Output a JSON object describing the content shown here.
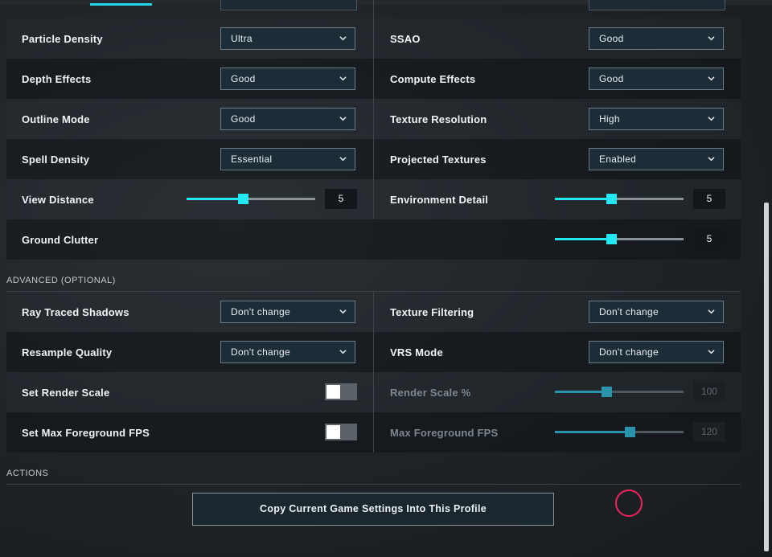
{
  "header": {
    "active_tab_color": "#21d4e8"
  },
  "graphics_settings": {
    "left": [
      {
        "label": "Particle Density",
        "type": "select",
        "value": "Ultra"
      },
      {
        "label": "Depth Effects",
        "type": "select",
        "value": "Good"
      },
      {
        "label": "Outline Mode",
        "type": "select",
        "value": "Good"
      },
      {
        "label": "Spell Density",
        "type": "select",
        "value": "Essential"
      },
      {
        "label": "View Distance",
        "type": "slider",
        "value": "5",
        "fraction": 0.44
      }
    ],
    "right": [
      {
        "label": "SSAO",
        "type": "select",
        "value": "Good"
      },
      {
        "label": "Compute Effects",
        "type": "select",
        "value": "Good"
      },
      {
        "label": "Texture Resolution",
        "type": "select",
        "value": "High"
      },
      {
        "label": "Projected Textures",
        "type": "select",
        "value": "Enabled"
      },
      {
        "label": "Environment Detail",
        "type": "slider",
        "value": "5",
        "fraction": 0.44
      }
    ],
    "full_width": {
      "label": "Ground Clutter",
      "type": "slider",
      "value": "5",
      "fraction": 0.44
    }
  },
  "advanced": {
    "title": "ADVANCED (OPTIONAL)",
    "left": [
      {
        "label": "Ray Traced Shadows",
        "type": "select",
        "value": "Don't change"
      },
      {
        "label": "Resample Quality",
        "type": "select",
        "value": "Don't change"
      },
      {
        "label": "Set Render Scale",
        "type": "toggle",
        "on": false
      },
      {
        "label": "Set Max Foreground FPS",
        "type": "toggle",
        "on": false
      }
    ],
    "right": [
      {
        "label": "Texture Filtering",
        "type": "select",
        "value": "Don't change"
      },
      {
        "label": "VRS Mode",
        "type": "select",
        "value": "Don't change"
      },
      {
        "label": "Render Scale %",
        "type": "slider",
        "value": "100",
        "fraction": 0.4,
        "disabled": true
      },
      {
        "label": "Max Foreground FPS",
        "type": "slider",
        "value": "120",
        "fraction": 0.58,
        "disabled": true
      }
    ]
  },
  "actions": {
    "title": "ACTIONS",
    "copy_button_label": "Copy Current Game Settings Into This Profile"
  },
  "colors": {
    "accent": "#22e8f2",
    "accent_disabled": "#2a94ac",
    "cursor": "#f0245c"
  },
  "icons": {
    "dropdown": "chevron-down-icon",
    "cursor": "cursor-ring"
  }
}
